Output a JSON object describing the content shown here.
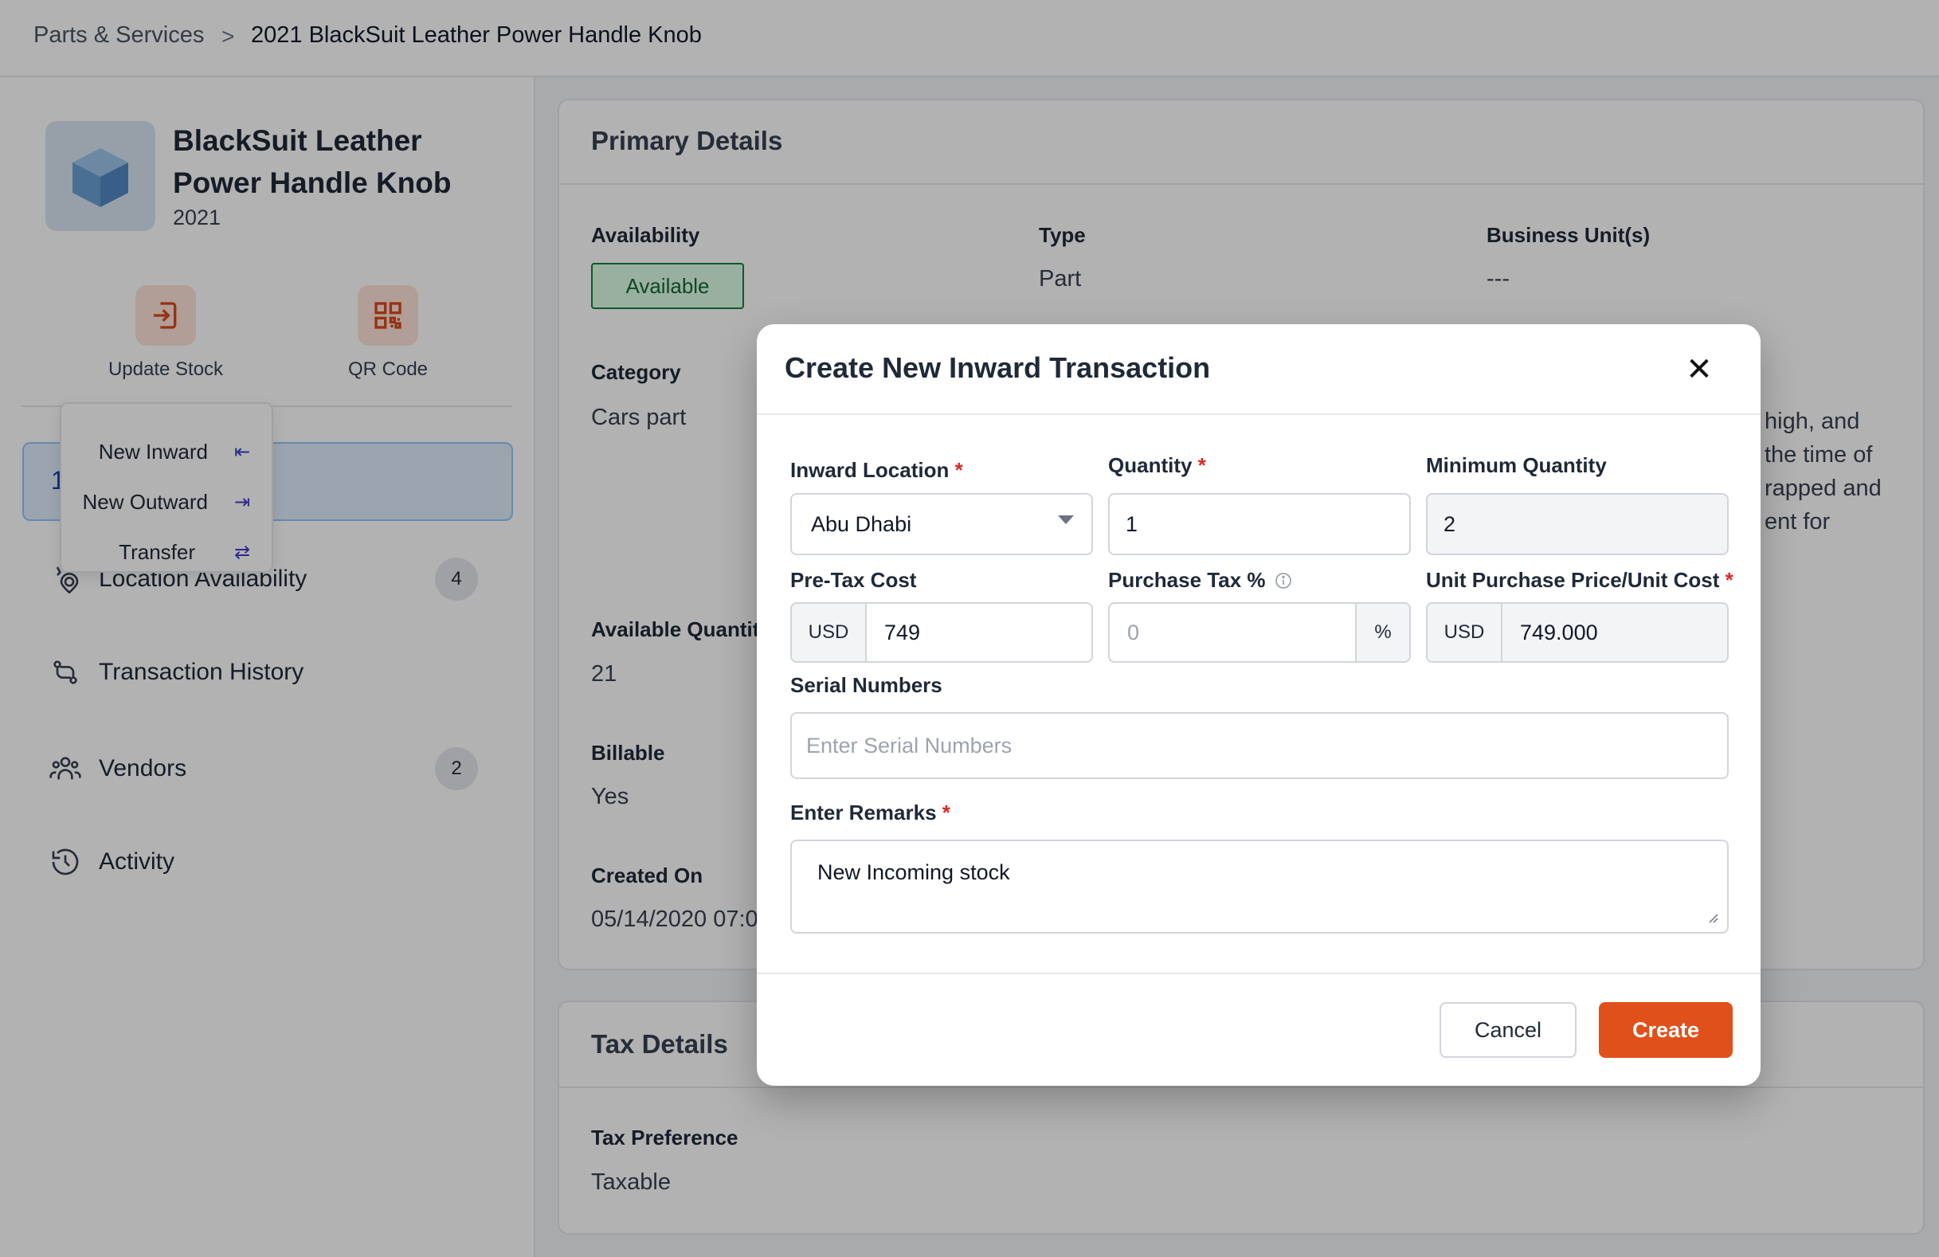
{
  "breadcrumb": {
    "root": "Parts & Services",
    "separator": ">",
    "current": "2021 BlackSuit Leather Power Handle Knob"
  },
  "product": {
    "name_line1": "BlackSuit Leather",
    "name_line2": "Power Handle Knob",
    "year": "2021"
  },
  "actions": {
    "update_stock": "Update Stock",
    "qr_code": "QR Code"
  },
  "stock_menu": {
    "items": [
      "New Inward",
      "New Outward",
      "Transfer"
    ]
  },
  "nav": {
    "location_availability": {
      "label": "Location Availability",
      "count": "4"
    },
    "transaction_history": {
      "label": "Transaction History"
    },
    "vendors": {
      "label": "Vendors",
      "count": "2"
    },
    "activity": {
      "label": "Activity"
    }
  },
  "primary": {
    "title": "Primary Details",
    "availability_label": "Availability",
    "availability_value": "Available",
    "type_label": "Type",
    "type_value": "Part",
    "bu_label": "Business Unit(s)",
    "bu_value": "---",
    "category_label": "Category",
    "category_value": "Cars part",
    "desc_fragments": [
      "high, and",
      "the time of",
      "rapped and",
      "ent for"
    ],
    "avail_qty_label": "Available Quantity",
    "avail_qty_value": "21",
    "billable_label": "Billable",
    "billable_value": "Yes",
    "created_label": "Created On",
    "created_value": "05/14/2020 07:0"
  },
  "tax": {
    "title": "Tax Details",
    "pref_label": "Tax Preference",
    "pref_value": "Taxable"
  },
  "modal": {
    "title": "Create New Inward Transaction",
    "inward_location_label": "Inward Location",
    "inward_location_value": "Abu Dhabi",
    "quantity_label": "Quantity",
    "quantity_value": "1",
    "min_qty_label": "Minimum Quantity",
    "min_qty_value": "2",
    "pretax_label": "Pre-Tax Cost",
    "pretax_currency": "USD",
    "pretax_value": "749",
    "purchase_tax_label": "Purchase Tax %",
    "purchase_tax_placeholder": "0",
    "purchase_tax_suffix": "%",
    "unit_price_label": "Unit Purchase Price/Unit Cost",
    "unit_price_currency": "USD",
    "unit_price_value": "749.000",
    "serial_label": "Serial Numbers",
    "serial_placeholder": "Enter Serial Numbers",
    "remarks_label": "Enter Remarks",
    "remarks_value": "New Incoming stock",
    "cancel": "Cancel",
    "create": "Create"
  },
  "colors": {
    "primary_button": "#e0501b",
    "available_green": "#15803d",
    "required": "#dc2626"
  }
}
